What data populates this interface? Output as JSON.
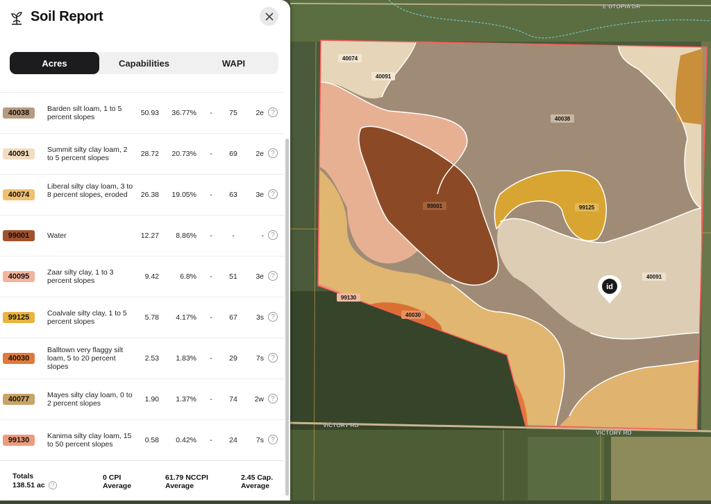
{
  "panel": {
    "title": "Soil Report",
    "close_icon": "close-icon",
    "title_icon": "plant-icon"
  },
  "tabs": [
    {
      "label": "Acres",
      "active": true
    },
    {
      "label": "Capabilities",
      "active": false
    },
    {
      "label": "WAPI",
      "active": false
    }
  ],
  "soils": [
    {
      "code": "40038",
      "color": "#b99a7e",
      "name": "Barden silt loam, 1 to 5 percent slopes",
      "acres": "50.93",
      "percent": "36.77%",
      "cpi": "-",
      "nccpi": "75",
      "cap": "2e"
    },
    {
      "code": "40091",
      "color": "#f4dcc0",
      "name": "Summit silty clay loam, 2 to 5 percent slopes",
      "acres": "28.72",
      "percent": "20.73%",
      "cpi": "-",
      "nccpi": "69",
      "cap": "2e"
    },
    {
      "code": "40074",
      "color": "#f0c070",
      "name": "Liberal silty clay loam, 3 to 8 percent slopes, eroded",
      "acres": "26.38",
      "percent": "19.05%",
      "cpi": "-",
      "nccpi": "63",
      "cap": "3e"
    },
    {
      "code": "99001",
      "color": "#a0522d",
      "name": "Water",
      "acres": "12.27",
      "percent": "8.86%",
      "cpi": "-",
      "nccpi": "-",
      "cap": "-"
    },
    {
      "code": "40095",
      "color": "#f4b49c",
      "name": "Zaar silty clay, 1 to 3 percent slopes",
      "acres": "9.42",
      "percent": "6.8%",
      "cpi": "-",
      "nccpi": "51",
      "cap": "3e"
    },
    {
      "code": "99125",
      "color": "#e8b440",
      "name": "Coalvale silty clay, 1 to 5 percent slopes",
      "acres": "5.78",
      "percent": "4.17%",
      "cpi": "-",
      "nccpi": "67",
      "cap": "3s"
    },
    {
      "code": "40030",
      "color": "#e2793a",
      "name": "Balltown very flaggy silt loam, 5 to 20 percent slopes",
      "acres": "2.53",
      "percent": "1.83%",
      "cpi": "-",
      "nccpi": "29",
      "cap": "7s"
    },
    {
      "code": "40077",
      "color": "#c9a468",
      "name": "Mayes silty clay loam, 0 to 2 percent slopes",
      "acres": "1.90",
      "percent": "1.37%",
      "cpi": "-",
      "nccpi": "74",
      "cap": "2w"
    },
    {
      "code": "99130",
      "color": "#ed9b7e",
      "name": "Kanima silty clay loam, 15 to 50 percent slopes",
      "acres": "0.58",
      "percent": "0.42%",
      "cpi": "-",
      "nccpi": "24",
      "cap": "7s"
    }
  ],
  "footer": {
    "totals_label": "Totals",
    "totals_value": "138.51 ac",
    "cpi_value": "0 CPI",
    "cpi_label": "Average",
    "nccpi_value": "61.79 NCCPI",
    "nccpi_label": "Average",
    "cap_value": "2.45 Cap.",
    "cap_label": "Average"
  },
  "map": {
    "roads": [
      "E UTOPIA DR",
      "VICTORY RD",
      "VICTORY RD"
    ],
    "polygon_labels": [
      "40074",
      "40091",
      "40038",
      "99001",
      "99125",
      "40091",
      "99130",
      "40030"
    ],
    "marker_text": "id"
  }
}
